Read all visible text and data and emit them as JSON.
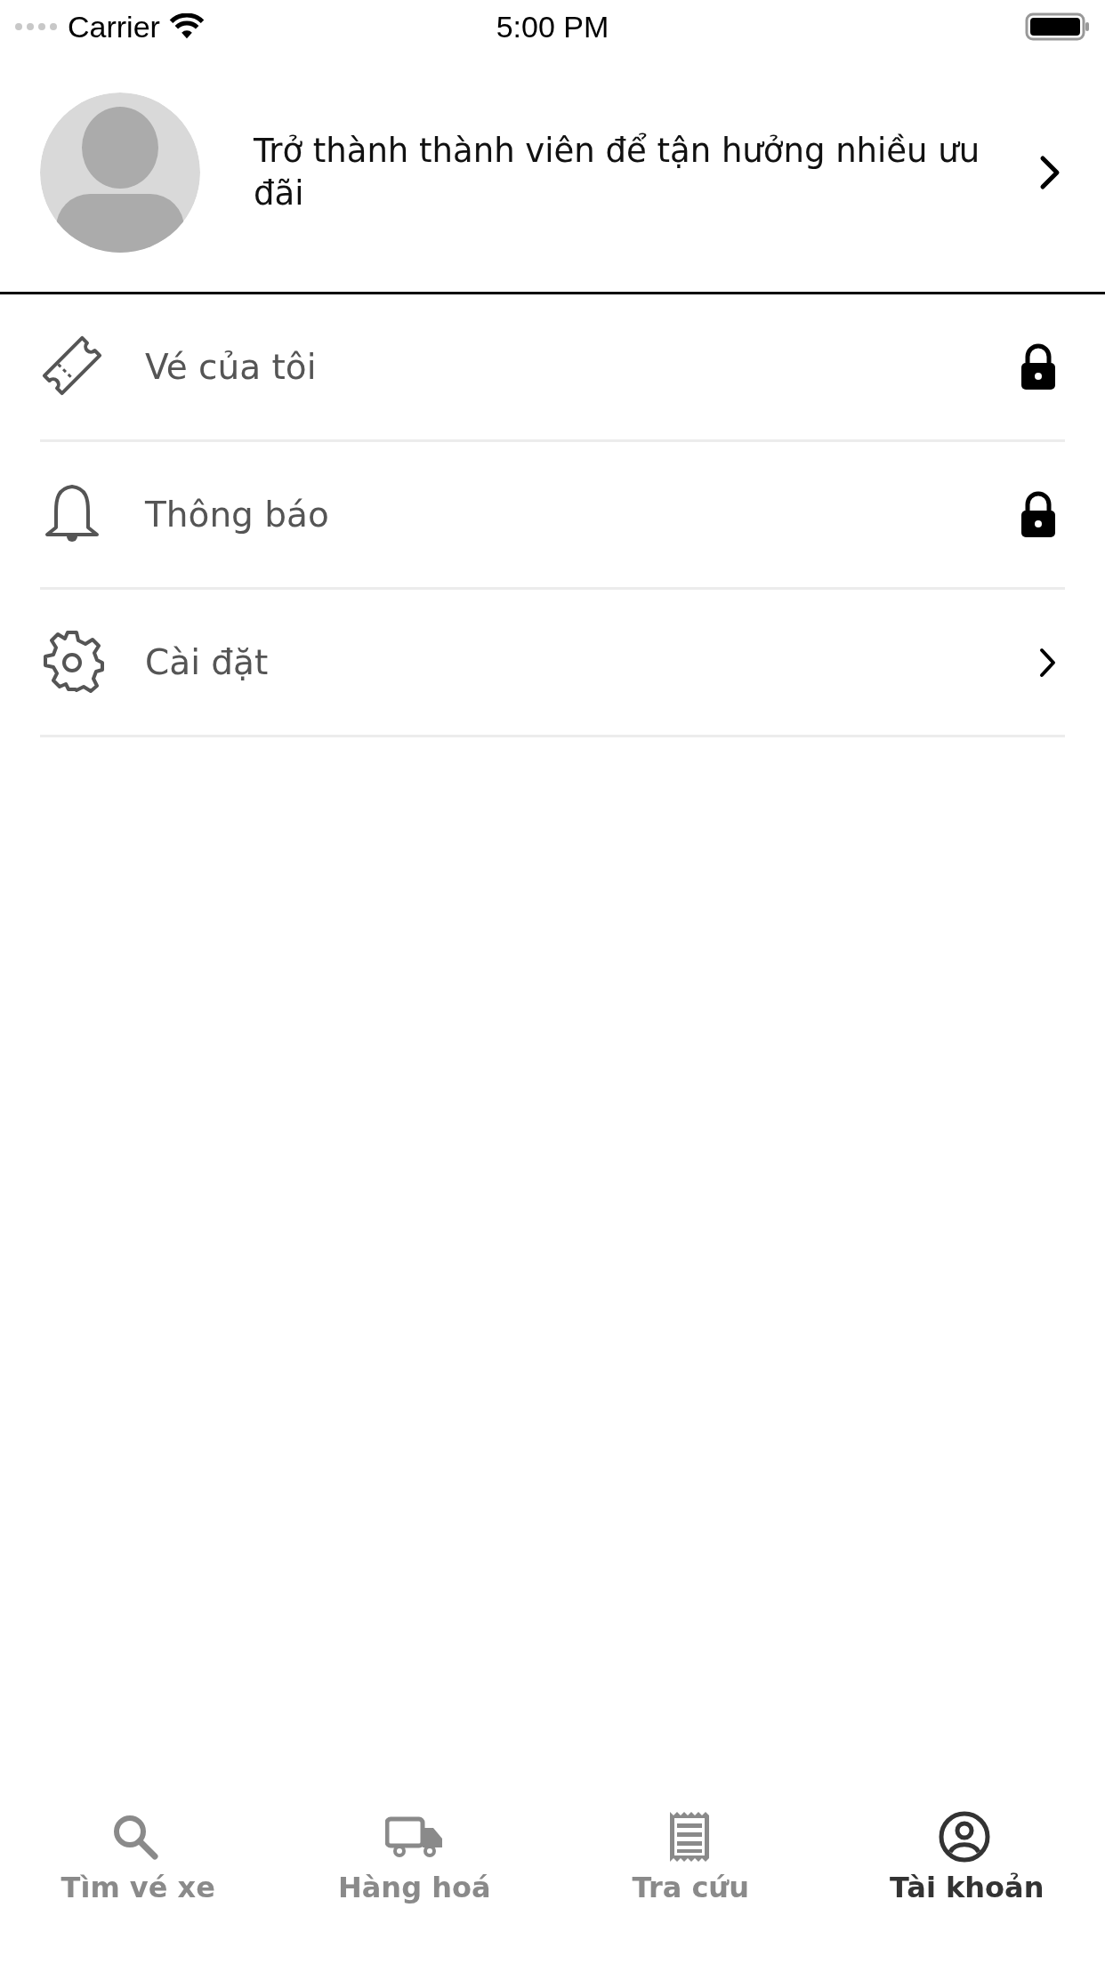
{
  "status_bar": {
    "carrier": "Carrier",
    "time": "5:00 PM"
  },
  "profile": {
    "message": "Trở thành thành viên để tận hưởng nhiều ưu đãi"
  },
  "menu": [
    {
      "kind": "ticket",
      "label": "Vé của tôi",
      "locked": true
    },
    {
      "kind": "bell",
      "label": "Thông báo",
      "locked": true
    },
    {
      "kind": "gear",
      "label": "Cài đặt",
      "locked": false
    }
  ],
  "tabs": [
    {
      "kind": "search",
      "label": "Tìm vé xe",
      "selected": false
    },
    {
      "kind": "truck",
      "label": "Hàng hoá",
      "selected": false
    },
    {
      "kind": "receipt",
      "label": "Tra cứu",
      "selected": false
    },
    {
      "kind": "account",
      "label": "Tài khoản",
      "selected": true
    }
  ]
}
